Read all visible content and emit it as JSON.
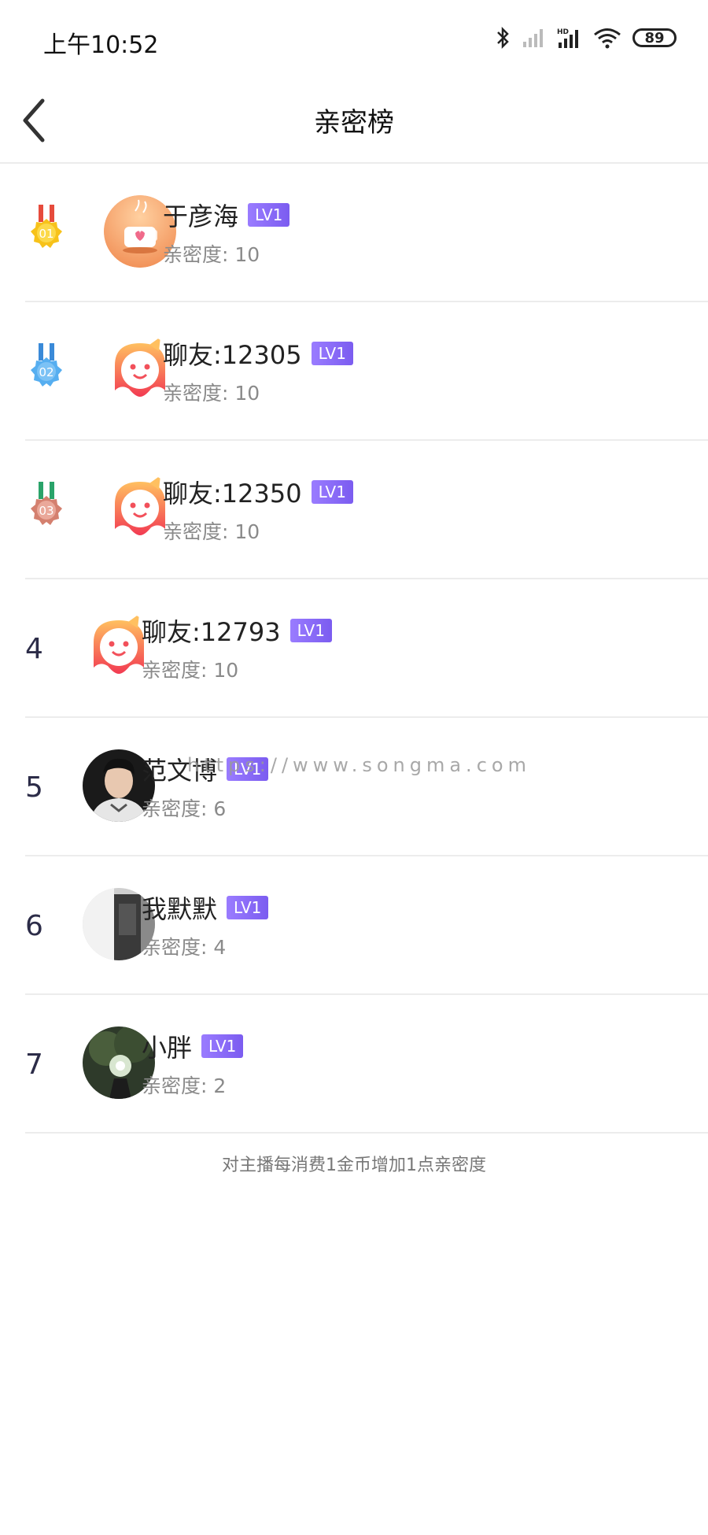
{
  "status_bar": {
    "time": "上午10:52",
    "battery": "89",
    "icons": [
      "bluetooth-icon",
      "signal-icon",
      "hd-signal-icon",
      "wifi-icon",
      "battery-icon"
    ]
  },
  "nav": {
    "title": "亲密榜",
    "back_icon": "chevron-left-icon"
  },
  "items": [
    {
      "rank": "1",
      "medal": "01",
      "medal_color": "#f7c21a",
      "name": "于彦海",
      "level": "LV1",
      "score": "亲密度: 10",
      "avatar": "cake"
    },
    {
      "rank": "2",
      "medal": "02",
      "medal_color": "#56aef0",
      "name": "聊友:12305",
      "level": "LV1",
      "score": "亲密度: 10",
      "avatar": "mascot"
    },
    {
      "rank": "3",
      "medal": "03",
      "medal_color": "#e0988a",
      "name": "聊友:12350",
      "level": "LV1",
      "score": "亲密度: 10",
      "avatar": "mascot"
    },
    {
      "rank": "4",
      "name": "聊友:12793",
      "level": "LV1",
      "score": "亲密度: 10",
      "avatar": "mascot"
    },
    {
      "rank": "5",
      "name": "范文博",
      "level": "LV1",
      "score": "亲密度: 6",
      "avatar": "photo-man"
    },
    {
      "rank": "6",
      "name": "我默默",
      "level": "LV1",
      "score": "亲密度: 4",
      "avatar": "photo-room"
    },
    {
      "rank": "7",
      "name": "小胖",
      "level": "LV1",
      "score": "亲密度: 2",
      "avatar": "photo-tree"
    }
  ],
  "footer_note": "对主播每消费1金币增加1点亲密度",
  "watermark": "https://www.songma.com",
  "colors": {
    "lv_badge": "#8a6cf5",
    "divider": "#ececec",
    "score_text": "#8a8a8a"
  }
}
